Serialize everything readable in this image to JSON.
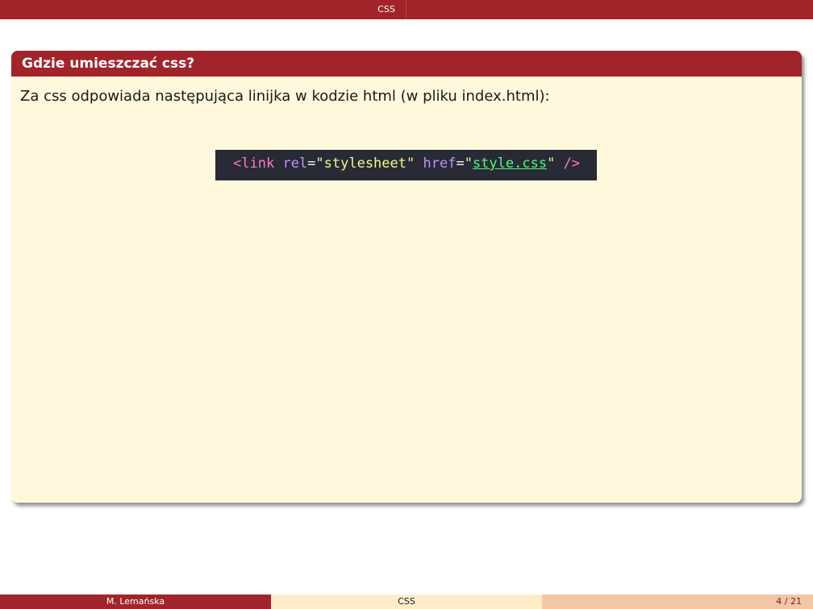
{
  "header": {
    "section": "CSS"
  },
  "block": {
    "title": "Gdzie umieszczać css?",
    "text": "Za css odpowiada następująca linijka w kodzie html (w pliku index.html):"
  },
  "code": {
    "tag_open": "<link",
    "attr_rel": "rel",
    "eq1": "=",
    "val_rel": "\"stylesheet\"",
    "attr_href": "href",
    "eq2": "=",
    "quote_open": "\"",
    "val_href": "style.css",
    "quote_close": "\"",
    "tag_close": "/>"
  },
  "footer": {
    "author": "M. Lemańska",
    "title": "CSS",
    "page": "4 / 21"
  },
  "colors": {
    "theme": "#a1242a",
    "block_bg": "#fff8dc",
    "code_bg": "#282a36"
  }
}
